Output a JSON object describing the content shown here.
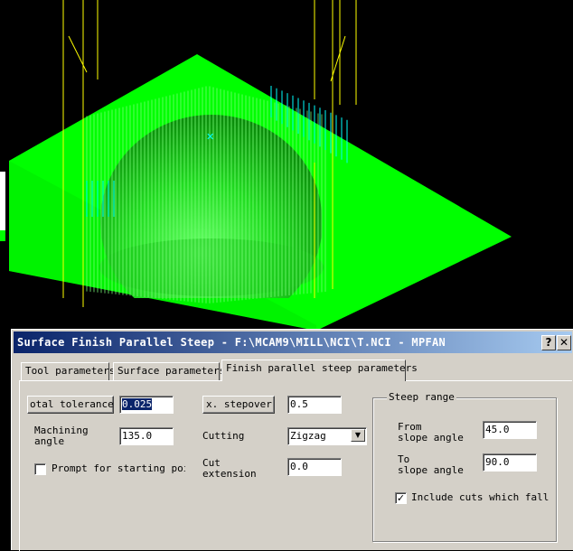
{
  "dialog": {
    "title": "Surface Finish Parallel Steep - F:\\MCAM9\\MILL\\NCI\\T.NCI - MPFAN",
    "help_glyph": "?",
    "close_glyph": "✕",
    "tabs": [
      {
        "label": "Tool parameters",
        "active": false
      },
      {
        "label": "Surface parameters",
        "active": false
      },
      {
        "label": "Finish parallel steep parameters",
        "active": true
      }
    ]
  },
  "params": {
    "total_tolerance_button": "otal tolerance...",
    "total_tolerance_value": "0.025",
    "max_stepover_button": "x. stepover...",
    "max_stepover_value": "0.5",
    "machining_angle_label_1": "Machining",
    "machining_angle_label_2": "angle",
    "machining_angle_value": "135.0",
    "cutting_label": "Cutting",
    "cutting_value": "Zigzag",
    "prompt_start_label": "Prompt for starting point",
    "prompt_start_checked": false,
    "cut_extension_label_1": "Cut",
    "cut_extension_label_2": "extension",
    "cut_extension_value": "0.0"
  },
  "steep_range": {
    "legend": "Steep range",
    "from_label_1": "From",
    "from_label_2": "slope angle",
    "from_value": "45.0",
    "to_label_1": "To",
    "to_label_2": "slope angle",
    "to_value": "90.0",
    "include_cuts_label": "Include cuts which fall out",
    "include_cuts_checked": true,
    "check_glyph": "✓"
  },
  "colors": {
    "surface_green": "#00ff00",
    "toolpath_cyan": "#00ffff",
    "tool_yellow": "#ffff00",
    "title_blue": "#0a246a",
    "dialog_gray": "#d4d0c8"
  },
  "viewport": {
    "icons": [
      "toolpath-start-marker-icon"
    ]
  }
}
